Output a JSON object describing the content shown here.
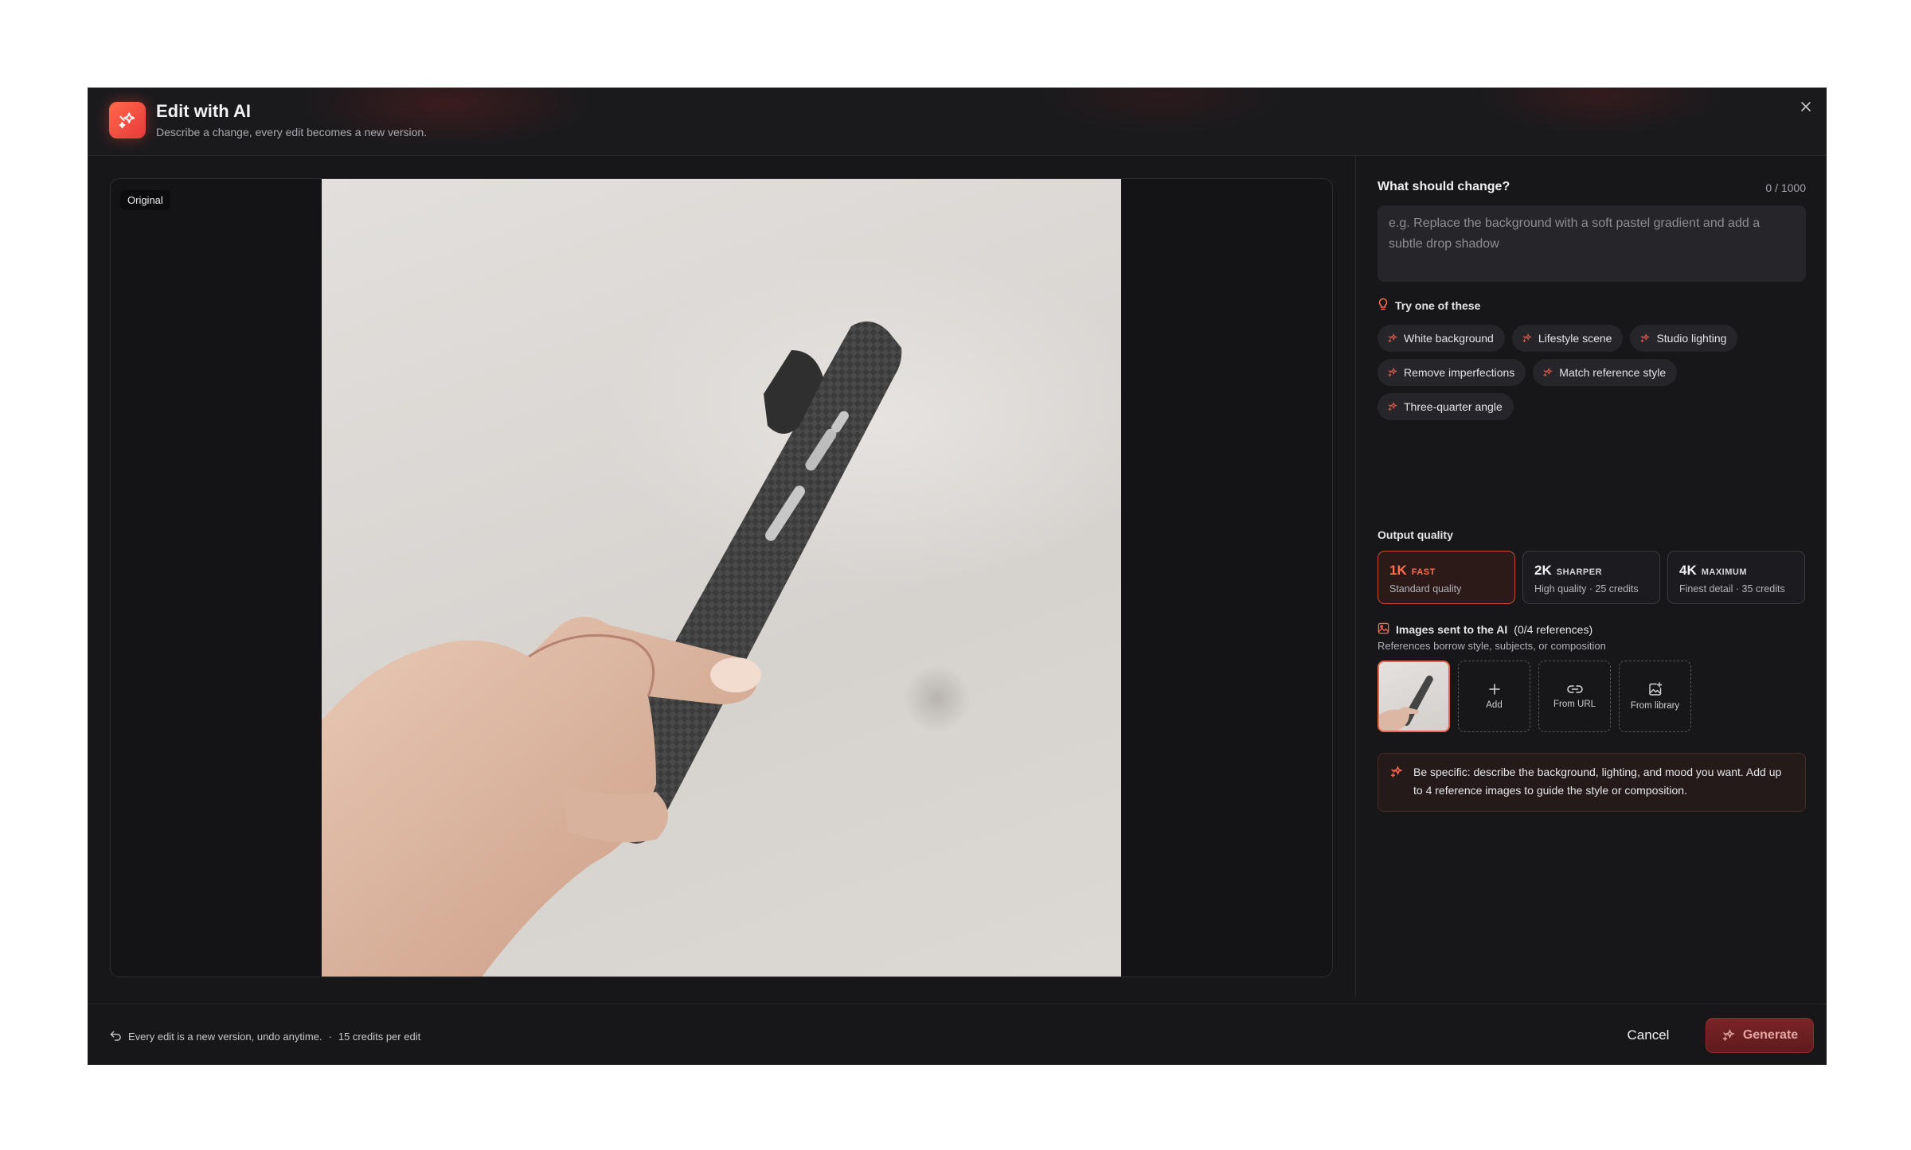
{
  "header": {
    "title": "Edit with AI",
    "subtitle": "Describe a change, every edit becomes a new version."
  },
  "preview": {
    "badge": "Original"
  },
  "prompt": {
    "label": "What should change?",
    "counter": "0 / 1000",
    "placeholder": "e.g. Replace the background with a soft pastel gradient and add a subtle drop shadow",
    "value": ""
  },
  "suggestions": {
    "label": "Try one of these",
    "chips": [
      "White background",
      "Lifestyle scene",
      "Studio lighting",
      "Remove imperfections",
      "Match reference style",
      "Three-quarter angle"
    ]
  },
  "quality": {
    "label": "Output quality",
    "selected": "1K",
    "options": [
      {
        "res": "1K",
        "tag": "FAST",
        "desc": "Standard quality"
      },
      {
        "res": "2K",
        "tag": "SHARPER",
        "desc": "High quality · 25 credits"
      },
      {
        "res": "4K",
        "tag": "MAXIMUM",
        "desc": "Finest detail · 35 credits"
      }
    ]
  },
  "references": {
    "label": "Images sent to the AI",
    "count": "(0/4 references)",
    "sub": "References borrow style, subjects, or composition",
    "add_label": "Add",
    "url_label": "From URL",
    "library_label": "From library"
  },
  "tip": {
    "text": "Be specific: describe the background, lighting, and mood you want. Add up to 4 reference images to guide the style or composition."
  },
  "footer": {
    "note": "Every edit is a new version, undo anytime.",
    "separator": "·",
    "credits": "15 credits per edit",
    "cancel_label": "Cancel",
    "generate_label": "Generate"
  },
  "colors": {
    "accent": "#ff6a4a",
    "modal_bg": "#17171a",
    "chip_bg": "#26262a",
    "selected_border": "#c84a35"
  },
  "icons": {
    "app": "sparkles-icon",
    "close": "close-icon",
    "suggestion": "lightbulb-icon",
    "chip": "sparkles-icon",
    "references": "image-icon",
    "add": "plus-icon",
    "url": "link-icon",
    "library": "image-plus-icon",
    "tip": "sparkles-icon",
    "footer": "undo-icon"
  }
}
